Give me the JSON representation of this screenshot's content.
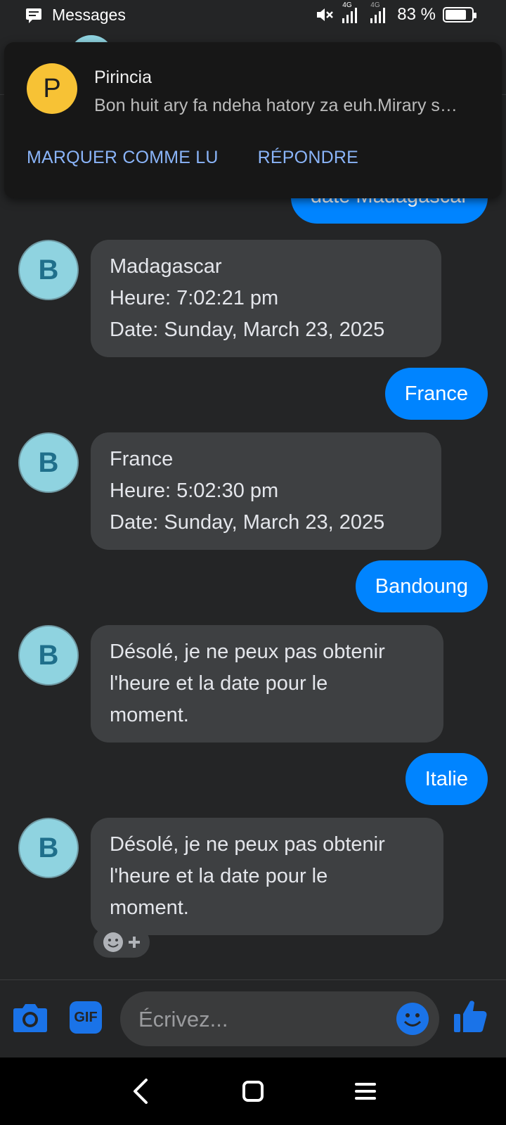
{
  "status_bar": {
    "app_label": "Messages",
    "network_1": "4G",
    "network_2": "4G",
    "battery": "83 %",
    "battery_level": 0.83
  },
  "notification": {
    "avatar_letter": "P",
    "sender": "Pirincia",
    "preview": "Bon huit ary fa ndeha hatory za euh.Mirary s…",
    "actions": [
      "MARQUER COMME LU",
      "RÉPONDRE"
    ]
  },
  "messages": [
    {
      "side": "out",
      "text": "date Madagascar"
    },
    {
      "side": "in",
      "avatar": "B",
      "lines": [
        "Madagascar",
        "Heure: 7:02:21 pm",
        "Date: Sunday, March 23, 2025"
      ]
    },
    {
      "side": "out",
      "text": "France"
    },
    {
      "side": "in",
      "avatar": "B",
      "lines": [
        "France",
        "Heure: 5:02:30 pm",
        "Date: Sunday, March 23, 2025"
      ]
    },
    {
      "side": "out",
      "text": "Bandoung"
    },
    {
      "side": "in",
      "avatar": "B",
      "lines": [
        "Désolé, je ne peux pas obtenir",
        "l'heure et la date pour le",
        "moment."
      ]
    },
    {
      "side": "out",
      "text": "Italie"
    },
    {
      "side": "in",
      "avatar": "B",
      "lines": [
        "Désolé, je ne peux pas obtenir",
        "l'heure et la date pour le",
        "moment."
      ]
    }
  ],
  "composer": {
    "gif_label": "GIF",
    "placeholder": "Écrivez..."
  },
  "colors": {
    "background": "#242526",
    "outgoing_bubble": "#0084ff",
    "incoming_bubble": "#3e4042",
    "accent": "#1a73e8",
    "notification_action": "#8ab4f8"
  }
}
